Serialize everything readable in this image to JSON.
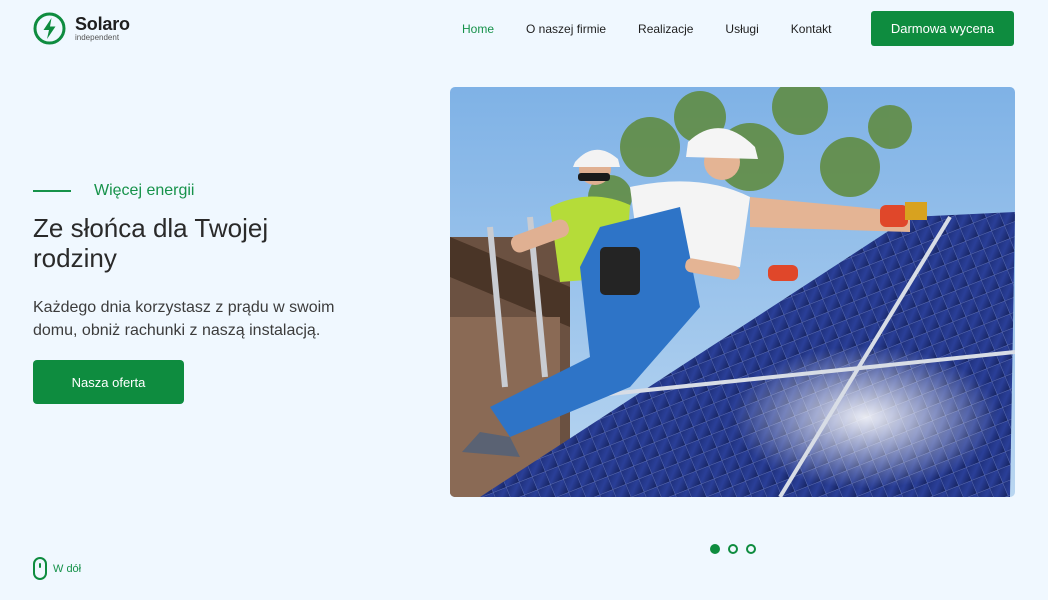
{
  "brand": {
    "name": "Solaro",
    "tagline": "independent",
    "icon": "lightning-bolt-icon",
    "color": "#0e8c3f"
  },
  "nav": {
    "items": [
      {
        "label": "Home",
        "active": true
      },
      {
        "label": "O naszej firmie",
        "active": false
      },
      {
        "label": "Realizacje",
        "active": false
      },
      {
        "label": "Usługi",
        "active": false
      },
      {
        "label": "Kontakt",
        "active": false
      }
    ],
    "cta": "Darmowa wycena"
  },
  "hero": {
    "eyebrow": "Więcej energii",
    "title": "Ze słońca dla Twojej rodziny",
    "description": "Każdego dnia korzystasz z prądu w swoim domu, obniż rachunki z naszą instalacją.",
    "cta": "Nasza oferta",
    "image": "solar-panel-installers-photo"
  },
  "slider": {
    "count": 3,
    "active": 0
  },
  "scroll": {
    "label": "W dół",
    "icon": "mouse-icon"
  }
}
